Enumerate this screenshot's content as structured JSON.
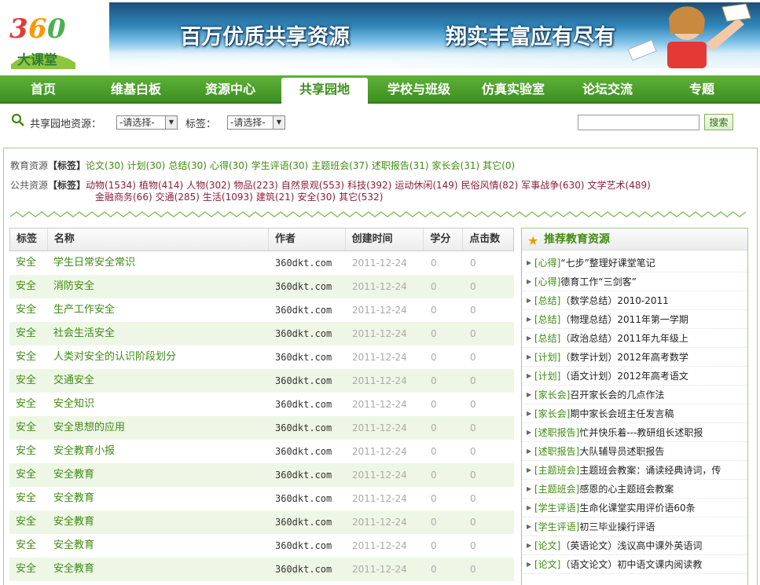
{
  "logo": {
    "text": "大课堂",
    "number": "360"
  },
  "banner": {
    "slogan1": "百万优质共享资源",
    "slogan2": "翔实丰富应有尽有"
  },
  "nav": [
    "首页",
    "维基白板",
    "资源中心",
    "共享园地",
    "学校与班级",
    "仿真实验室",
    "论坛交流",
    "专题"
  ],
  "search": {
    "label": "共享园地资源：",
    "select1": "-请选择-",
    "tag_label": "标签：",
    "select2": "-请选择-",
    "input_value": "",
    "button": "搜索"
  },
  "tags": {
    "edu_label": "教育资源",
    "edu_head": "【标签】",
    "edu": [
      "论文(30)",
      "计划(30)",
      "总结(30)",
      "心得(30)",
      "学生评语(30)",
      "主题班会(37)",
      "述职报告(31)",
      "家长会(31)",
      "其它(0)"
    ],
    "pub_label": "公共资源",
    "pub_head": "【标签】",
    "pub_row1": [
      "动物(1534)",
      "植物(414)",
      "人物(302)",
      "物品(223)",
      "自然景观(553)",
      "科技(392)",
      "运动休闲(149)",
      "民俗风情(82)",
      "军事战争(630)",
      "文学艺术(489)"
    ],
    "pub_row2": [
      "金融商务(66)",
      "交通(285)",
      "生活(1093)",
      "建筑(21)",
      "安全(30)",
      "其它(532)"
    ]
  },
  "table": {
    "headers": [
      "标签",
      "名称",
      "作者",
      "创建时间",
      "学分",
      "点击数"
    ],
    "rows": [
      [
        "安全",
        "学生日常安全常识",
        "360dkt.com",
        "2011-12-24",
        "0",
        "0"
      ],
      [
        "安全",
        "消防安全",
        "360dkt.com",
        "2011-12-24",
        "0",
        "0"
      ],
      [
        "安全",
        "生产工作安全",
        "360dkt.com",
        "2011-12-24",
        "0",
        "0"
      ],
      [
        "安全",
        "社会生活安全",
        "360dkt.com",
        "2011-12-24",
        "0",
        "0"
      ],
      [
        "安全",
        "人类对安全的认识阶段划分",
        "360dkt.com",
        "2011-12-24",
        "0",
        "0"
      ],
      [
        "安全",
        "交通安全",
        "360dkt.com",
        "2011-12-24",
        "0",
        "0"
      ],
      [
        "安全",
        "安全知识",
        "360dkt.com",
        "2011-12-24",
        "0",
        "0"
      ],
      [
        "安全",
        "安全思想的应用",
        "360dkt.com",
        "2011-12-24",
        "0",
        "0"
      ],
      [
        "安全",
        "安全教育小报",
        "360dkt.com",
        "2011-12-24",
        "0",
        "0"
      ],
      [
        "安全",
        "安全教育",
        "360dkt.com",
        "2011-12-24",
        "0",
        "0"
      ],
      [
        "安全",
        "安全教育",
        "360dkt.com",
        "2011-12-24",
        "0",
        "0"
      ],
      [
        "安全",
        "安全教育",
        "360dkt.com",
        "2011-12-24",
        "0",
        "0"
      ],
      [
        "安全",
        "安全教育",
        "360dkt.com",
        "2011-12-24",
        "0",
        "0"
      ],
      [
        "安全",
        "安全教育",
        "360dkt.com",
        "2011-12-24",
        "0",
        "0"
      ]
    ]
  },
  "recommend": {
    "title": "推荐教育资源",
    "items": [
      {
        "cat": "[心得]",
        "title": "“七步”整理好课堂笔记"
      },
      {
        "cat": "[心得]",
        "title": "德育工作“三剑客”"
      },
      {
        "cat": "[总结]",
        "title": "（数学总结）2010-2011"
      },
      {
        "cat": "[总结]",
        "title": "（物理总结）2011年第一学期"
      },
      {
        "cat": "[总结]",
        "title": "（政治总结）2011年九年级上"
      },
      {
        "cat": "[计划]",
        "title": "（数学计划）2012年高考数学"
      },
      {
        "cat": "[计划]",
        "title": "（语文计划）2012年高考语文"
      },
      {
        "cat": "[家长会]",
        "title": "召开家长会的几点作法"
      },
      {
        "cat": "[家长会]",
        "title": "期中家长会班主任发言稿"
      },
      {
        "cat": "[述职报告]",
        "title": "忙并快乐着---教研组长述职报"
      },
      {
        "cat": "[述职报告]",
        "title": "大队辅导员述职报告"
      },
      {
        "cat": "[主题班会]",
        "title": "主题班会教案：诵读经典诗词，传"
      },
      {
        "cat": "[主题班会]",
        "title": "感恩的心主题班会教案"
      },
      {
        "cat": "[学生评语]",
        "title": "生命化课堂实用评价语60条"
      },
      {
        "cat": "[学生评语]",
        "title": "初三毕业操行评语"
      },
      {
        "cat": "[论文]",
        "title": "（英语论文）浅议高中课外英语词"
      },
      {
        "cat": "[论文]",
        "title": "（语文论文）初中语文课内阅读教"
      }
    ]
  },
  "colors": {
    "nav_green": "#4a9e2a",
    "link_green": "#3f8b12",
    "tag_red": "#8b1f3a",
    "row_alt": "#eef7e6"
  }
}
